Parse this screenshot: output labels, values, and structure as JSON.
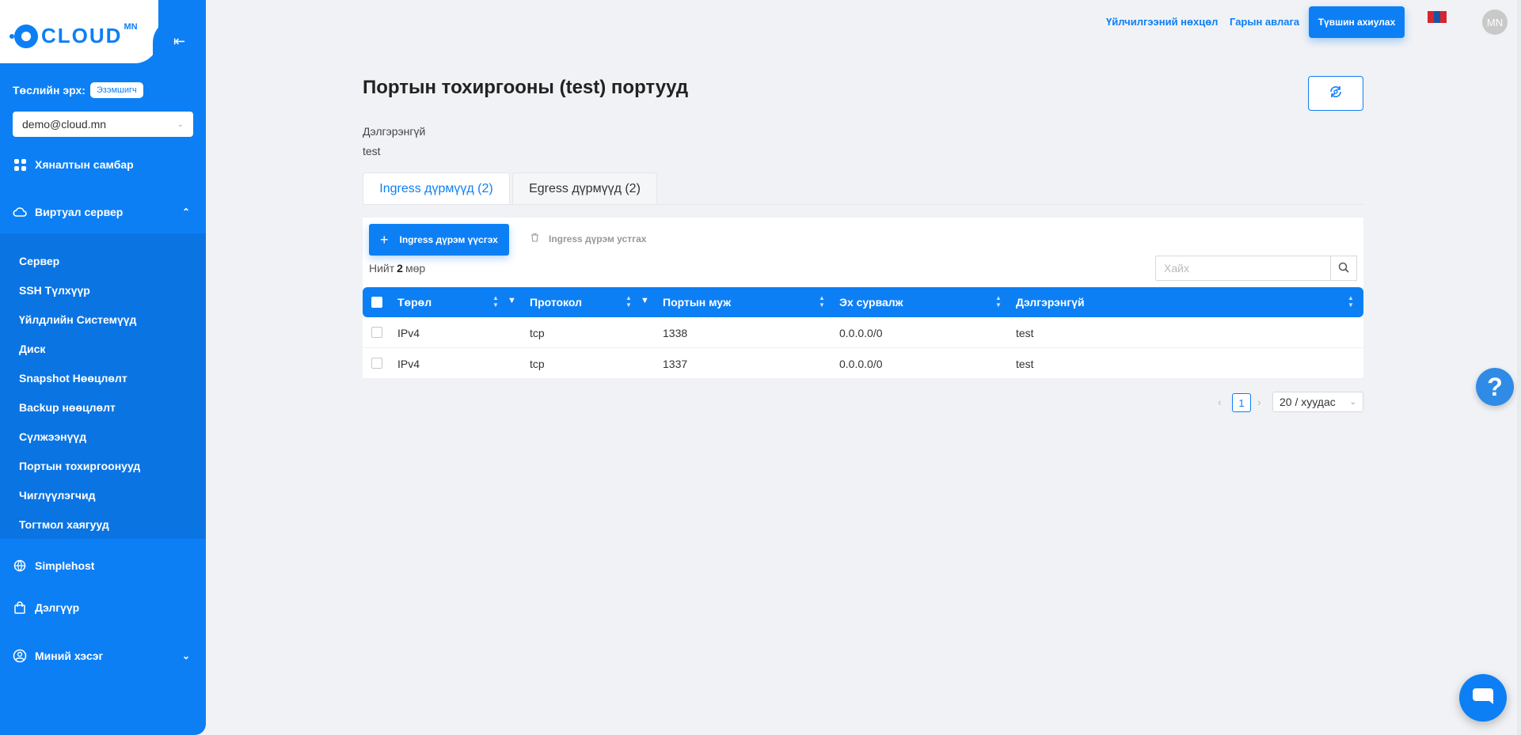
{
  "brand": {
    "name": "CLOUD",
    "suffix": "MN"
  },
  "sidebar": {
    "role_label": "Төслийн эрх:",
    "role_badge": "Эзэмшигч",
    "account": "demo@cloud.mn",
    "dashboard": "Хяналтын самбар",
    "virtual_server": "Виртуал сервер",
    "sub_items": [
      "Сервер",
      "SSH Түлхүүр",
      "Үйлдлийн Системүүд",
      "Диск",
      "Snapshot Нөөцлөлт",
      "Backup нөөцлөлт",
      "Сүлжээнүүд",
      "Портын тохиргоонууд",
      "Чиглүүлэгчид",
      "Тогтмол хаягууд"
    ],
    "simplehost": "Simplehost",
    "shop": "Дэлгүүр",
    "my_section": "Миний хэсэг"
  },
  "topbar": {
    "terms": "Үйлчилгээний нөхцөл",
    "guide": "Гарын авлага",
    "topup": "Түвшин ахиулах",
    "avatar": "MN"
  },
  "page": {
    "title": "Портын тохиргооны (test) портууд",
    "desc_label": "Дэлгэрэнгүй",
    "desc_value": "test",
    "tabs": [
      "Ingress дүрмүүд (2)",
      "Egress дүрмүүд (2)"
    ],
    "add_button": "Ingress дүрэм үүсгэх",
    "delete_button": "Ingress дүрэм устгах",
    "total_prefix": "Нийт",
    "total_count": "2",
    "total_suffix": "мөр",
    "search_placeholder": "Хайх"
  },
  "table": {
    "columns": [
      "Төрөл",
      "Протокол",
      "Портын муж",
      "Эх сурвалж",
      "Дэлгэрэнгүй"
    ],
    "rows": [
      [
        "IPv4",
        "tcp",
        "1338",
        "0.0.0.0/0",
        "test"
      ],
      [
        "IPv4",
        "tcp",
        "1337",
        "0.0.0.0/0",
        "test"
      ]
    ]
  },
  "pagination": {
    "current": "1",
    "page_size": "20 / хуудас"
  },
  "colors": {
    "primary": "#0d7ff5",
    "background": "#f0f2f5"
  }
}
